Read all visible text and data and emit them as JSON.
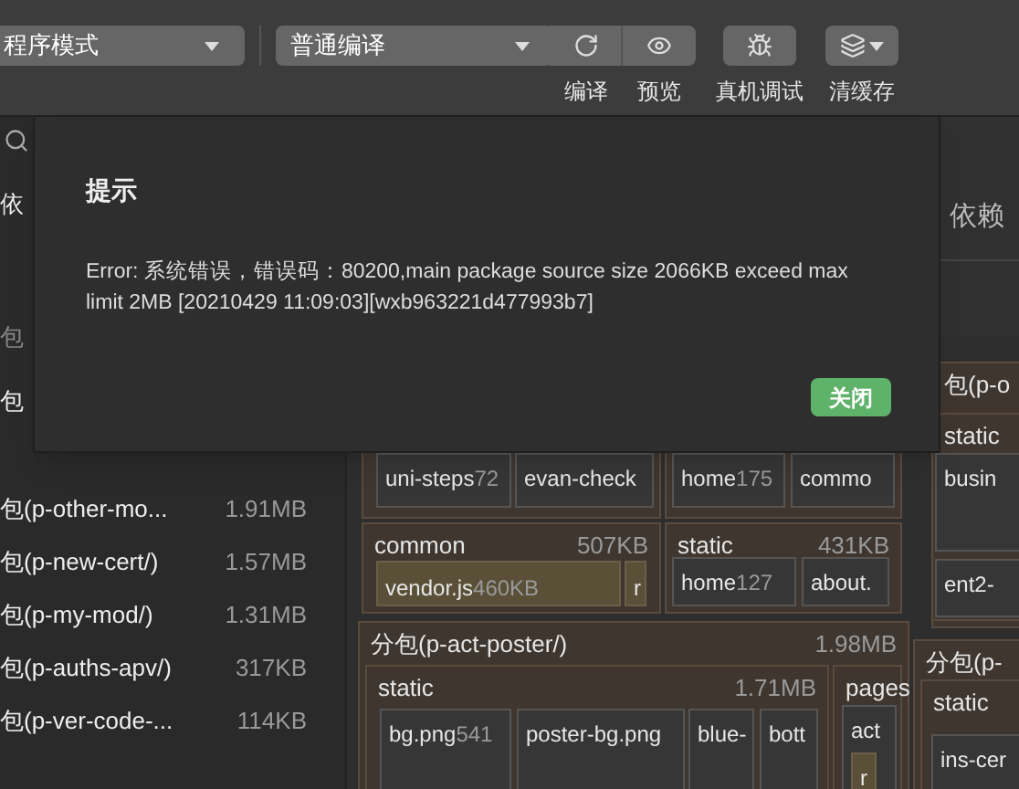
{
  "toolbar": {
    "mode_select": "程序模式",
    "compile_select": "普通编译",
    "buttons": [
      {
        "kind": "refresh",
        "label": "编译"
      },
      {
        "kind": "preview",
        "label": "预览"
      },
      {
        "kind": "debug",
        "label": "真机调试"
      },
      {
        "kind": "cache",
        "label": "清缓存"
      }
    ]
  },
  "sidebar": {
    "labels": [
      {
        "kind": "normal",
        "text": "依"
      },
      {
        "kind": "muted",
        "text": "包"
      },
      {
        "kind": "normal",
        "text": "包"
      }
    ],
    "packages": [
      {
        "name": "包(p-other-mo...",
        "size": "1.91MB"
      },
      {
        "name": "包(p-new-cert/)",
        "size": "1.57MB"
      },
      {
        "name": "包(p-my-mod/)",
        "size": "1.31MB"
      },
      {
        "name": "包(p-auths-apv/)",
        "size": "317KB"
      },
      {
        "name": "包(p-ver-code-...",
        "size": "114KB"
      }
    ]
  },
  "main": {
    "heading": "依赖"
  },
  "treemap": [
    {
      "kind": "group"
    },
    {
      "kind": "file",
      "name": "uni-steps",
      "size": "72"
    },
    {
      "kind": "file",
      "name": "evan-check"
    },
    {
      "kind": "group"
    },
    {
      "kind": "file",
      "name": "home",
      "size": "175"
    },
    {
      "kind": "file",
      "name": "commo"
    },
    {
      "kind": "group",
      "name": "common",
      "size": "507KB"
    },
    {
      "kind": "highlight",
      "name": "vendor.js",
      "size": "460KB"
    },
    {
      "kind": "highlight",
      "name": "r"
    },
    {
      "kind": "group",
      "name": "static",
      "size": "431KB"
    },
    {
      "kind": "file",
      "name": "home",
      "size": "127"
    },
    {
      "kind": "file",
      "name": "about."
    },
    {
      "kind": "group",
      "name": "分包(p-act-poster/)",
      "size": "1.98MB"
    },
    {
      "kind": "group",
      "name": "static",
      "size": "1.71MB"
    },
    {
      "kind": "file",
      "name": "bg.png",
      "size": "541"
    },
    {
      "kind": "file",
      "name": "poster-bg.png"
    },
    {
      "kind": "file",
      "name": "blue-"
    },
    {
      "kind": "file",
      "name": "bott"
    },
    {
      "kind": "group",
      "name": "pages"
    },
    {
      "kind": "file",
      "name": "act"
    },
    {
      "kind": "highlight",
      "name": "r"
    },
    {
      "kind": "group",
      "name": "包(p-o"
    },
    {
      "kind": "group",
      "name": "static"
    },
    {
      "kind": "file",
      "name": "busin"
    },
    {
      "kind": "file",
      "name": "ent2-"
    },
    {
      "kind": "group",
      "name": "分包(p-"
    },
    {
      "kind": "group",
      "name": "static"
    },
    {
      "kind": "file",
      "name": "ins-cer"
    }
  ],
  "dialog": {
    "title": "提示",
    "message": "Error: 系统错误，错误码：80200,main package source size 2066KB exceed max limit 2MB [20210429 11:09:03][wxb963221d477993b7]",
    "button": "关闭"
  }
}
